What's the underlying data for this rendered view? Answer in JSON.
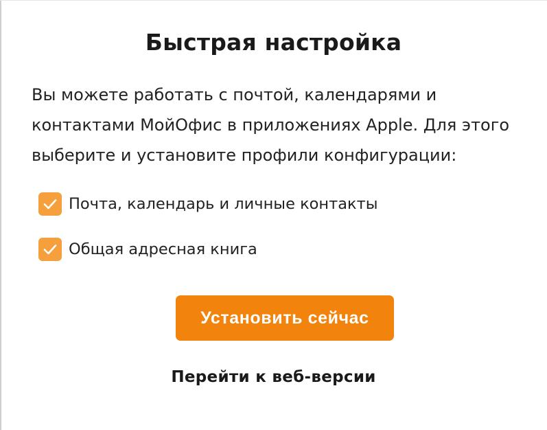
{
  "dialog": {
    "title": "Быстрая настройка",
    "description": "Вы можете работать с почтой, календарями и контактами МойОфис в приложениях Apple. Для этого выберите и установите профили конфигурации:"
  },
  "options": [
    {
      "label": "Почта, календарь и личные контакты",
      "checked": true,
      "icon": "checkmark-icon"
    },
    {
      "label": "Общая адресная книга",
      "checked": true,
      "icon": "checkmark-icon"
    }
  ],
  "actions": {
    "install_label": "Установить сейчас",
    "web_version_label": "Перейти к веб-версии"
  },
  "colors": {
    "accent": "#F2830C",
    "checkbox": "#F5A03C",
    "text": "#1F1F1F",
    "background": "#FFFFFF"
  }
}
